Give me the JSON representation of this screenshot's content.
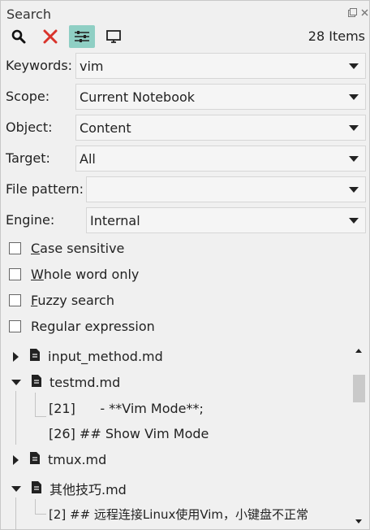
{
  "panel": {
    "title": "Search",
    "items_count": "28 Items"
  },
  "toolbar": {
    "search_icon": "search-icon",
    "clear_icon": "close-icon",
    "advanced_icon": "sliders-icon",
    "console_icon": "monitor-icon",
    "active_color": "#8fcfc4"
  },
  "form": {
    "keywords_label": "Keywords:",
    "keywords_value": "vim",
    "scope_label": "Scope:",
    "scope_value": "Current Notebook",
    "object_label": "Object:",
    "object_value": "Content",
    "target_label": "Target:",
    "target_value": "All",
    "file_pattern_label": "File pattern:",
    "file_pattern_value": "",
    "engine_label": "Engine:",
    "engine_value": "Internal"
  },
  "options": {
    "case_sensitive_first": "C",
    "case_sensitive_rest": "ase sensitive",
    "whole_word_first": "W",
    "whole_word_rest": "hole word only",
    "fuzzy_first": "F",
    "fuzzy_rest": "uzzy search",
    "regex_label": "Regular expression"
  },
  "results": [
    {
      "name": "input_method.md",
      "expanded": false
    },
    {
      "name": "testmd.md",
      "expanded": true,
      "matches": [
        "[21]      - **Vim Mode**;",
        "[26] ## Show Vim Mode"
      ]
    },
    {
      "name": "tmux.md",
      "expanded": false
    },
    {
      "name": "其他技巧.md",
      "expanded": true,
      "matches": [
        "[2] ## 远程连接Linux使用Vim，小键盘不正常"
      ]
    }
  ]
}
